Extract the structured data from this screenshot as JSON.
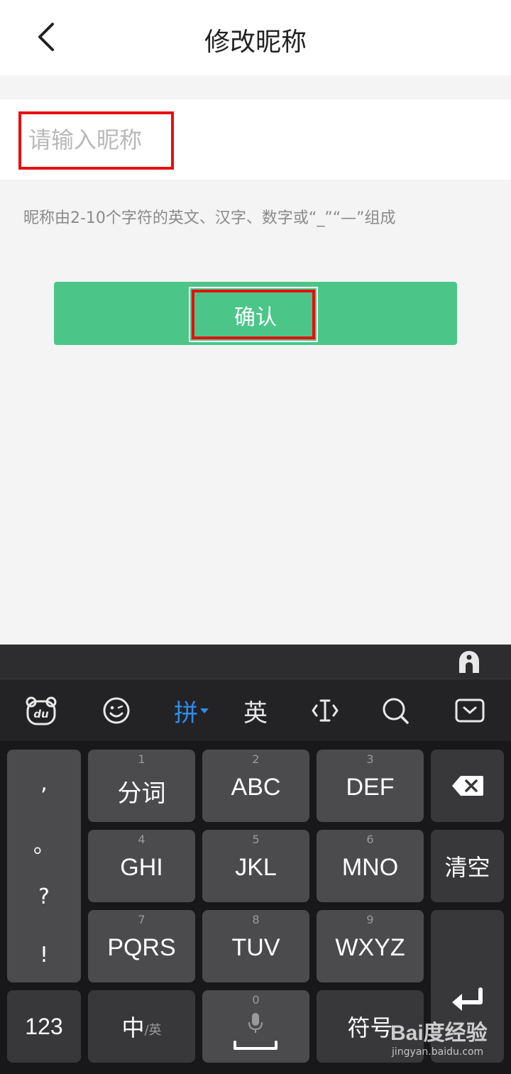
{
  "header": {
    "title": "修改昵称"
  },
  "form": {
    "placeholder": "请输入昵称",
    "value": "",
    "hint": "昵称由2-10个字符的英文、汉字、数字或“_”“—”组成",
    "confirm_label": "确认"
  },
  "keyboard": {
    "toolbar": {
      "pinyin_label": "拼",
      "english_label": "英"
    },
    "punct": [
      ",",
      "。",
      "?",
      "!"
    ],
    "keys": {
      "k1": {
        "num": "1",
        "label": "分词"
      },
      "k2": {
        "num": "2",
        "label": "ABC"
      },
      "k3": {
        "num": "3",
        "label": "DEF"
      },
      "k4": {
        "num": "4",
        "label": "GHI"
      },
      "k5": {
        "num": "5",
        "label": "JKL"
      },
      "k6": {
        "num": "6",
        "label": "MNO"
      },
      "k7": {
        "num": "7",
        "label": "PQRS"
      },
      "k8": {
        "num": "8",
        "label": "TUV"
      },
      "k9": {
        "num": "9",
        "label": "WXYZ"
      },
      "k0": {
        "num": "0"
      }
    },
    "clear_label": "清空",
    "numeric_label": "123",
    "lang_main": "中",
    "lang_sub": "/英",
    "symbol_label": "符号"
  },
  "watermark": {
    "logo": "Bai度经验",
    "url": "jingyan.baidu.com"
  },
  "colors": {
    "accent": "#4bc688",
    "highlight": "#e60f0f",
    "active_tab": "#2d8cf0"
  }
}
